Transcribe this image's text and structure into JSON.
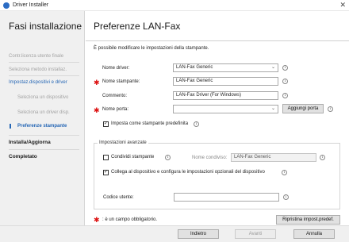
{
  "window": {
    "title": "Driver Installer",
    "close_glyph": "✕"
  },
  "sidebar": {
    "title": "Fasi installazione",
    "items": [
      {
        "label": "Contr.licenza utente finale"
      },
      {
        "label": "Seleziona metodo installaz."
      },
      {
        "label": "Impostaz.dispositivi e driver"
      },
      {
        "label": "Seleziona un dispositivo"
      },
      {
        "label": "Seleziona un driver disp."
      },
      {
        "label": "Preferenze stampante"
      },
      {
        "label": "Installa/Aggiorna"
      },
      {
        "label": "Completato"
      }
    ]
  },
  "main": {
    "title": "Preferenze LAN-Fax",
    "description": "È possibile modificare le impostazioni della stampante.",
    "driver_name": {
      "label": "Nome driver:",
      "value": "LAN-Fax Generic"
    },
    "printer_name": {
      "label": "Nome stampante:",
      "value": "LAN-Fax Generic"
    },
    "comment": {
      "label": "Commento:",
      "value": "LAN-Fax Driver (For Windows)"
    },
    "port_name": {
      "label": "Nome porta:",
      "value": "",
      "add_button": "Aggiungi porta"
    },
    "default_printer": {
      "label": "Imposta come stampante predefinita",
      "checked": true
    },
    "advanced": {
      "title": "Impostazioni avanzate",
      "share": {
        "label": "Condividi stampante",
        "checked": false
      },
      "share_name": {
        "label": "Nome condiviso:",
        "value": "LAN-Fax Generic"
      },
      "connect": {
        "label": "Collega al dispositivo e configura le impostazioni opzionali del dispositivo",
        "checked": true
      },
      "user_code": {
        "label": "Codice utente:",
        "value": ""
      }
    },
    "required_note": ": è un campo obbligatorio.",
    "restore_button": "Ripristina impost.predef."
  },
  "footer": {
    "back": "Indietro",
    "next": "Avanti",
    "cancel": "Annulla"
  },
  "icons": {
    "info": "info-icon",
    "required": "required-asterisk-icon",
    "dropdown": "chevron-down-icon",
    "check": "checkmark-icon"
  },
  "colors": {
    "accent": "#2667b5",
    "required": "#dd1111"
  }
}
